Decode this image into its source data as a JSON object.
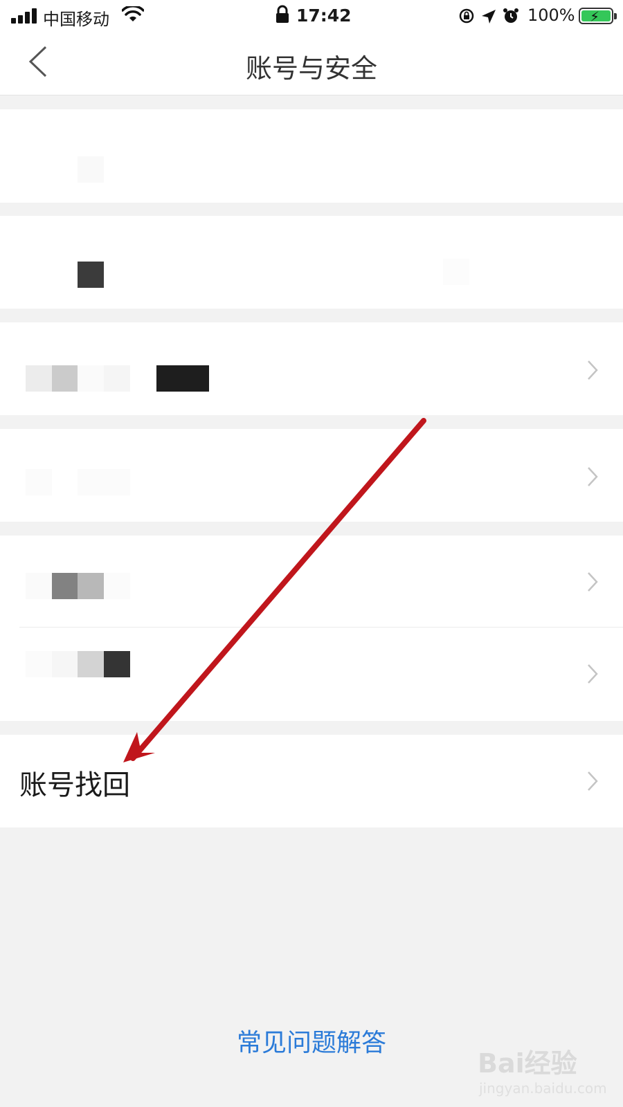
{
  "status_bar": {
    "carrier": "中国移动",
    "time": "17:42",
    "battery": "100%"
  },
  "nav": {
    "title": "账号与安全",
    "back_icon": "chevron-left-icon"
  },
  "rows": {
    "account_recovery_label": "账号找回"
  },
  "footer": {
    "faq_link": "常见问题解答"
  },
  "watermark": {
    "main": "Bai经验",
    "sub": "jingyan.baidu.com"
  },
  "colors": {
    "annotation_arrow": "#c0161c",
    "link": "#2b7bd8",
    "battery_fill": "#34c759"
  }
}
